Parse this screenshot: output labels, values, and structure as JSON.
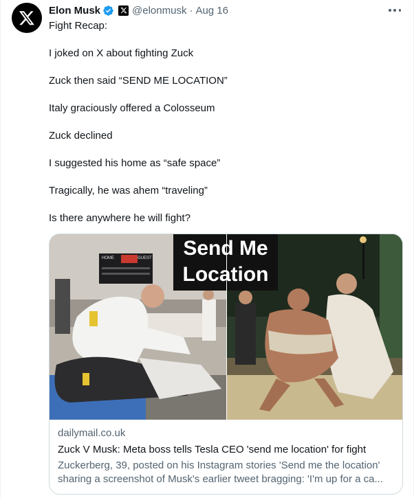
{
  "tweet": {
    "author_name": "Elon Musk",
    "handle": "@elonmusk",
    "separator": "·",
    "date": "Aug 16",
    "lines": [
      "Fight Recap:",
      "I joked on X about fighting Zuck",
      "Zuck then said “SEND ME LOCATION”",
      "Italy graciously offered a Colosseum",
      "Zuck declined",
      "I suggested his home as “safe space”",
      "Tragically, he was ahem “traveling”",
      "Is there anywhere he will fight?"
    ]
  },
  "card": {
    "overlay_line1": "Send Me",
    "overlay_line2": "Location",
    "scoreboard_home": "HOME",
    "scoreboard_guest": "GUEST",
    "domain": "dailymail.co.uk",
    "title": "Zuck V Musk: Meta boss tells Tesla CEO 'send me location' for fight",
    "description_line1": "Zuckerberg, 39, posted on his Instagram stories 'Send me the location'",
    "description_line2": "sharing a screenshot of Musk's earlier tweet bragging: 'I'm up for a ca..."
  },
  "colors": {
    "text_primary": "#0f1419",
    "text_secondary": "#536471",
    "verified_blue": "#1d9bf0",
    "border": "#cfd9de"
  },
  "icons": [
    "x-logo-icon",
    "verified-badge-icon",
    "x-affiliate-icon",
    "more-options-icon"
  ]
}
